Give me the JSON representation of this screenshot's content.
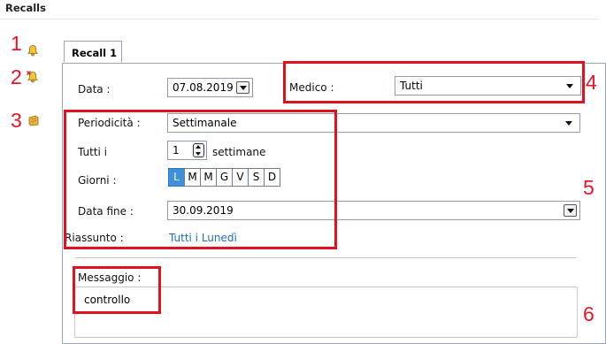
{
  "section": {
    "title": "Recalls"
  },
  "callouts": {
    "n1": "1",
    "n2": "2",
    "n3": "3",
    "n4": "4",
    "n5": "5",
    "n6": "6"
  },
  "icons": {
    "bell": "bell-icon",
    "bell_delete": "bell-delete-icon",
    "note": "note-icon"
  },
  "tab": {
    "label": "Recall 1"
  },
  "form": {
    "data_label": "Data :",
    "data_value": "07.08.2019",
    "medico_label": "Medico :",
    "medico_value": "Tutti",
    "periodicita_label": "Periodicità :",
    "periodicita_value": "Settimanale",
    "tutti_label": "Tutti i",
    "tutti_value": "1",
    "tutti_unit": "settimane",
    "giorni_label": "Giorni :",
    "days": [
      "L",
      "M",
      "M",
      "G",
      "V",
      "S",
      "D"
    ],
    "selected_day": "L",
    "data_fine_label": "Data fine :",
    "data_fine_value": "30.09.2019",
    "riassunto_label": "Riassunto :",
    "riassunto_value": "Tutti i Lunedì",
    "messaggio_label": "Messaggio :",
    "messaggio_value": "controllo"
  },
  "colors": {
    "highlight": "#e0101e",
    "accent": "#3e8fdc",
    "link": "#1f6fc0",
    "border": "#9aa6b5"
  }
}
